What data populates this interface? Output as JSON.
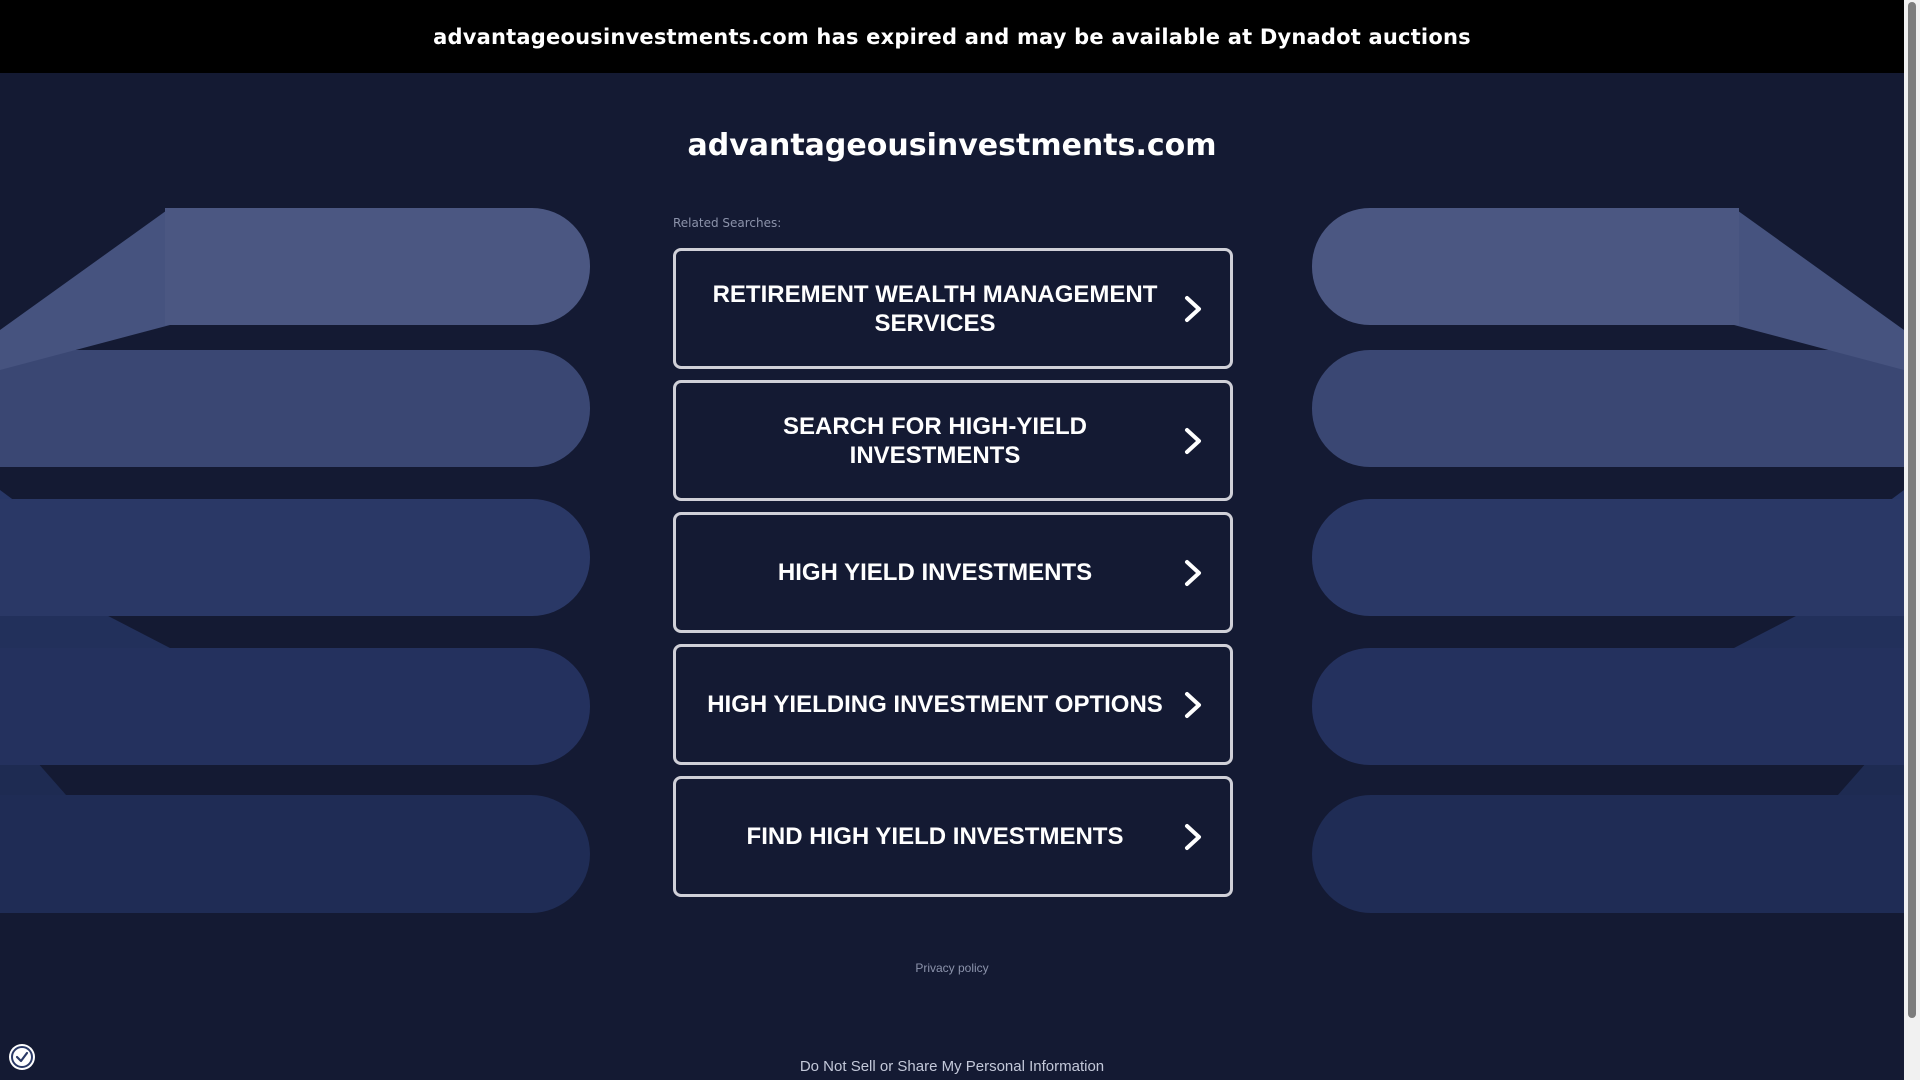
{
  "banner": {
    "text": "advantageousinvestments.com has expired and may be available at Dynadot auctions"
  },
  "domain": {
    "title": "advantageousinvestments.com"
  },
  "related": {
    "label": "Related Searches:",
    "items": [
      {
        "label": "RETIREMENT WEALTH MANAGEMENT SERVICES"
      },
      {
        "label": "SEARCH FOR HIGH-YIELD INVESTMENTS"
      },
      {
        "label": "HIGH YIELD INVESTMENTS"
      },
      {
        "label": "HIGH YIELDING INVESTMENT OPTIONS"
      },
      {
        "label": "FIND HIGH YIELD INVESTMENTS"
      }
    ]
  },
  "footer": {
    "privacy": "Privacy policy",
    "do_not_sell": "Do Not Sell or Share My Personal Information"
  },
  "icons": {
    "link_arrow": "chevron-right-icon",
    "consent": "privacy-consent-icon"
  },
  "colors": {
    "background": "#141a33",
    "banner": "#000000",
    "text": "#ffffff",
    "box_border": "#d0d0d8"
  }
}
